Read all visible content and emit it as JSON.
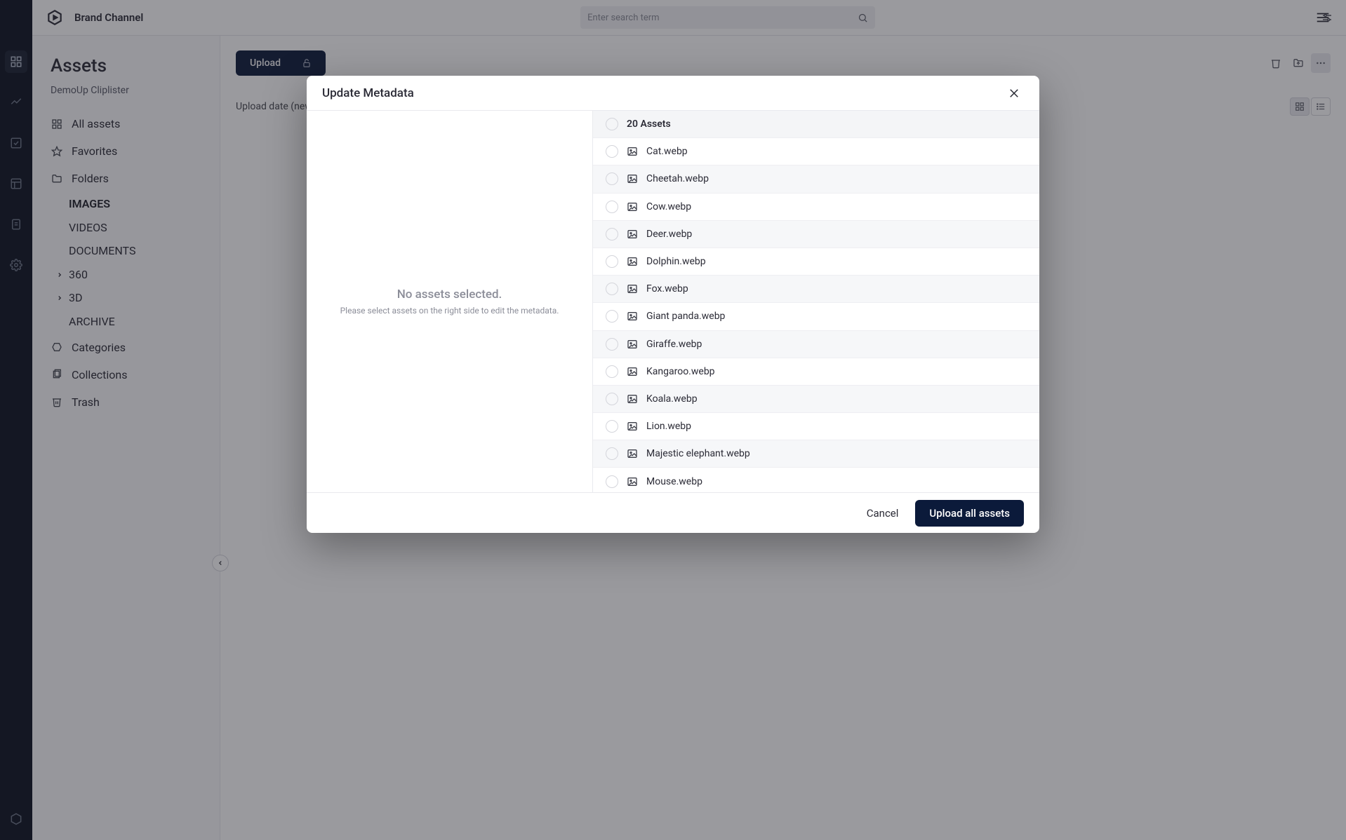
{
  "header": {
    "brand": "Brand Channel",
    "search_placeholder": "Enter search term"
  },
  "sidebar": {
    "title": "Assets",
    "breadcrumb": "DemoUp Cliplister",
    "items": {
      "all": "All assets",
      "fav": "Favorites",
      "folders": "Folders",
      "cats": "Categories",
      "colls": "Collections",
      "trash": "Trash"
    },
    "folders": [
      "IMAGES",
      "VIDEOS",
      "DOCUMENTS",
      "360",
      "3D",
      "ARCHIVE"
    ]
  },
  "toolbar": {
    "upload": "Upload",
    "sort": "Upload date (newest first)"
  },
  "modal": {
    "title": "Update Metadata",
    "empty_title": "No assets selected.",
    "empty_sub": "Please select assets on the right side to edit the metadata.",
    "count_label": "20 Assets",
    "cancel": "Cancel",
    "primary": "Upload all assets",
    "assets": [
      "Cat.webp",
      "Cheetah.webp",
      "Cow.webp",
      "Deer.webp",
      "Dolphin.webp",
      "Fox.webp",
      "Giant panda.webp",
      "Giraffe.webp",
      "Kangaroo.webp",
      "Koala.webp",
      "Lion.webp",
      "Majestic elephant.webp",
      "Mouse.webp"
    ]
  }
}
